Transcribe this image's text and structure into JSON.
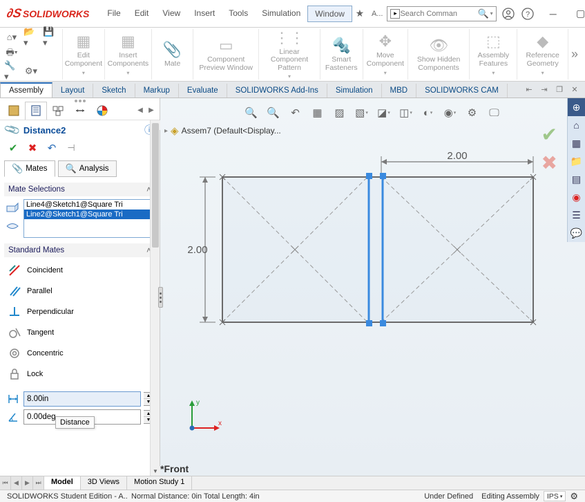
{
  "app": {
    "name": "SOLIDWORKS"
  },
  "menu": {
    "items": [
      "File",
      "Edit",
      "View",
      "Insert",
      "Tools",
      "Simulation",
      "Window"
    ],
    "active_index": 6
  },
  "title_right": {
    "star_label": "A...",
    "search_placeholder": "Search Comman"
  },
  "ribbon": {
    "groups": [
      {
        "label": "Edit Component"
      },
      {
        "label": "Insert Components"
      },
      {
        "label": "Mate"
      },
      {
        "label": "Component Preview Window"
      },
      {
        "label": "Linear Component Pattern"
      },
      {
        "label": "Smart Fasteners"
      },
      {
        "label": "Move Component"
      },
      {
        "label": "Show Hidden Components"
      },
      {
        "label": "Assembly Features"
      },
      {
        "label": "Reference Geometry"
      }
    ]
  },
  "doc_tabs": {
    "items": [
      "Assembly",
      "Layout",
      "Sketch",
      "Markup",
      "Evaluate",
      "SOLIDWORKS Add-Ins",
      "Simulation",
      "MBD",
      "SOLIDWORKS CAM"
    ],
    "active_index": 0
  },
  "property": {
    "title": "Distance2",
    "mates_label": "Mates",
    "analysis_label": "Analysis",
    "sections": {
      "selections_label": "Mate Selections",
      "standard_label": "Standard Mates"
    },
    "selections": [
      "Line4@Sketch1@Square Tri",
      "Line2@Sketch1@Square Tri"
    ],
    "standard_mates": {
      "coincident": "Coincident",
      "parallel": "Parallel",
      "perpendicular": "Perpendicular",
      "tangent": "Tangent",
      "concentric": "Concentric",
      "lock": "Lock"
    },
    "distance_value": "8.00in",
    "angle_value": "0.00deg",
    "tooltip": "Distance"
  },
  "breadcrumb": {
    "doc": "Assem7  (Default<Display..."
  },
  "drawing": {
    "dim_top": "2.00",
    "dim_left": "2.00",
    "view_label": "*Front"
  },
  "triad": {
    "x": "x",
    "y": "y"
  },
  "bottom_tabs": {
    "items": [
      "Model",
      "3D Views",
      "Motion Study 1"
    ],
    "active_index": 0
  },
  "status": {
    "left": "SOLIDWORKS Student Edition - A...",
    "mid": "Normal Distance: 0in Total Length: 4in",
    "def": "Under Defined",
    "mode": "Editing Assembly",
    "units": "IPS"
  }
}
